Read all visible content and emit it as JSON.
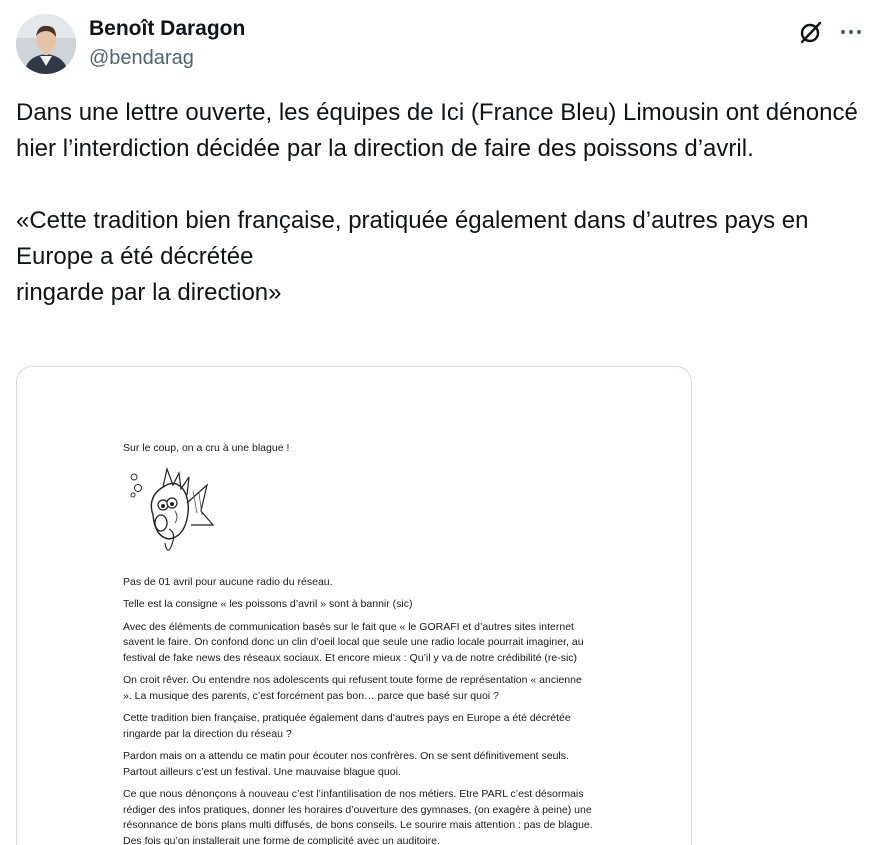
{
  "author": {
    "name": "Benoît Daragon",
    "handle": "@bendarag"
  },
  "tweet": {
    "paragraph1": "Dans une lettre ouverte, les équipes de Ici (France Bleu) Limousin ont dénoncé hier l’interdiction décidée par la direction de faire des poissons d’avril.",
    "quote_line1": "«Cette tradition bien française, pratiquée également dans d’autres pays en Europe a été décrétée",
    "quote_line2": "ringarde par la direction»"
  },
  "icons": {
    "grok": "grok-icon",
    "more": "more-icon"
  },
  "document": {
    "line1": "Sur le coup, on a cru à une blague !",
    "p1": "Pas de 01 avril pour aucune radio du réseau.",
    "p2": "Telle est la consigne « les poissons d’avril » sont à bannir (sic)",
    "p3": "Avec des éléments de communication basés sur le fait que « le GORAFI et d’autres sites internet savent le faire. On confond donc un clin d’oeil local que seule une radio locale pourrait imaginer, au festival de fake news des réseaux sociaux. Et encore mieux : Qu’il y va de notre crédibilité (re-sic)",
    "p4": "On croit rêver. Ou entendre nos adolescents qui refusent toute forme de représentation « ancienne ». La musique des parents, c’est forcément pas bon… parce que basé sur quoi ?",
    "p5": "Cette tradition bien française, pratiquée également dans d’autres pays en Europe a été décrétée ringarde par la direction du réseau ?",
    "p6": "Pardon mais on a attendu ce matin pour écouter nos confrères. On se sent définitivement seuls. Partout ailleurs c’est un festival. Une mauvaise blague quoi.",
    "p7": "Ce que nous dénonçons à nouveau c’est l’infantilisation de nos métiers. Etre PARL c’est désormais rédiger des infos pratiques, donner les horaires d’ouverture des gymnases, (on exagère à peine) une résonnance de bons plans multi diffusés, de bons conseils. Le sourire mais attention : pas de blague. Des fois qu’on installerait une forme de complicité avec un auditoire."
  },
  "colors": {
    "text": "#0f1419",
    "secondary": "#536471",
    "border": "#cfd9de"
  }
}
